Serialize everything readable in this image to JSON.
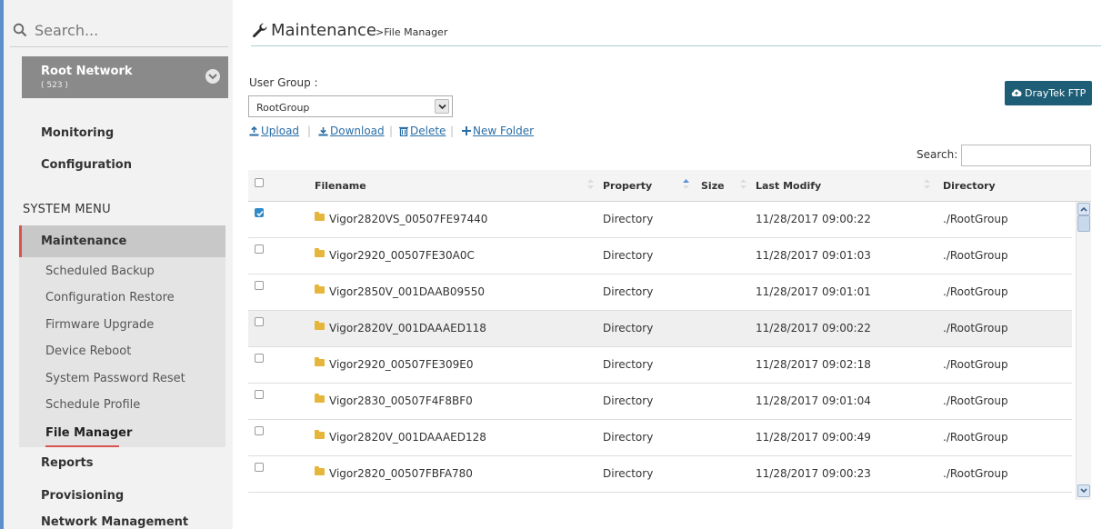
{
  "sidebar": {
    "search_placeholder": "Search...",
    "root_network": {
      "title": "Root Network",
      "count": "( 523 )"
    },
    "top_items": [
      "Monitoring",
      "Configuration"
    ],
    "system_menu_title": "SYSTEM MENU",
    "maintenance_label": "Maintenance",
    "sub_items": [
      "Scheduled Backup",
      "Configuration Restore",
      "Firmware Upgrade",
      "Device Reboot",
      "System Password Reset",
      "Schedule Profile",
      "File Manager"
    ],
    "bottom_items": [
      "Reports",
      "Provisioning",
      "Network Management"
    ]
  },
  "header": {
    "title": "Maintenance",
    "crumb": ">File Manager"
  },
  "user_group": {
    "label": "User Group :",
    "selected": "RootGroup"
  },
  "ftp_button": "DrayTek FTP",
  "toolbar": {
    "upload": "Upload",
    "download": "Download",
    "delete": "Delete",
    "new_folder": "New Folder"
  },
  "table_search_label": "Search:",
  "table": {
    "columns": {
      "filename": "Filename",
      "property": "Property",
      "size": "Size",
      "last_modify": "Last Modify",
      "directory": "Directory"
    },
    "rows": [
      {
        "name": "Vigor2820VS_00507FE97440",
        "property": "Directory",
        "size": "",
        "date": "11/28/2017 09:00:22",
        "dir": "./RootGroup",
        "checked": true
      },
      {
        "name": "Vigor2920_00507FE30A0C",
        "property": "Directory",
        "size": "",
        "date": "11/28/2017 09:01:03",
        "dir": "./RootGroup",
        "checked": false
      },
      {
        "name": "Vigor2850V_001DAAB09550",
        "property": "Directory",
        "size": "",
        "date": "11/28/2017 09:01:01",
        "dir": "./RootGroup",
        "checked": false
      },
      {
        "name": "Vigor2820V_001DAAAED118",
        "property": "Directory",
        "size": "",
        "date": "11/28/2017 09:00:22",
        "dir": "./RootGroup",
        "checked": false
      },
      {
        "name": "Vigor2920_00507FE309E0",
        "property": "Directory",
        "size": "",
        "date": "11/28/2017 09:02:18",
        "dir": "./RootGroup",
        "checked": false
      },
      {
        "name": "Vigor2830_00507F4F8BF0",
        "property": "Directory",
        "size": "",
        "date": "11/28/2017 09:01:04",
        "dir": "./RootGroup",
        "checked": false
      },
      {
        "name": "Vigor2820V_001DAAAED128",
        "property": "Directory",
        "size": "",
        "date": "11/28/2017 09:00:49",
        "dir": "./RootGroup",
        "checked": false
      },
      {
        "name": "Vigor2820_00507FBFA780",
        "property": "Directory",
        "size": "",
        "date": "11/28/2017 09:00:23",
        "dir": "./RootGroup",
        "checked": false
      }
    ]
  },
  "colors": {
    "accent": "#d9534f",
    "primary_button": "#1d5d76",
    "link": "#2a6ea6",
    "sidebar_edge": "#5d8fc9"
  }
}
